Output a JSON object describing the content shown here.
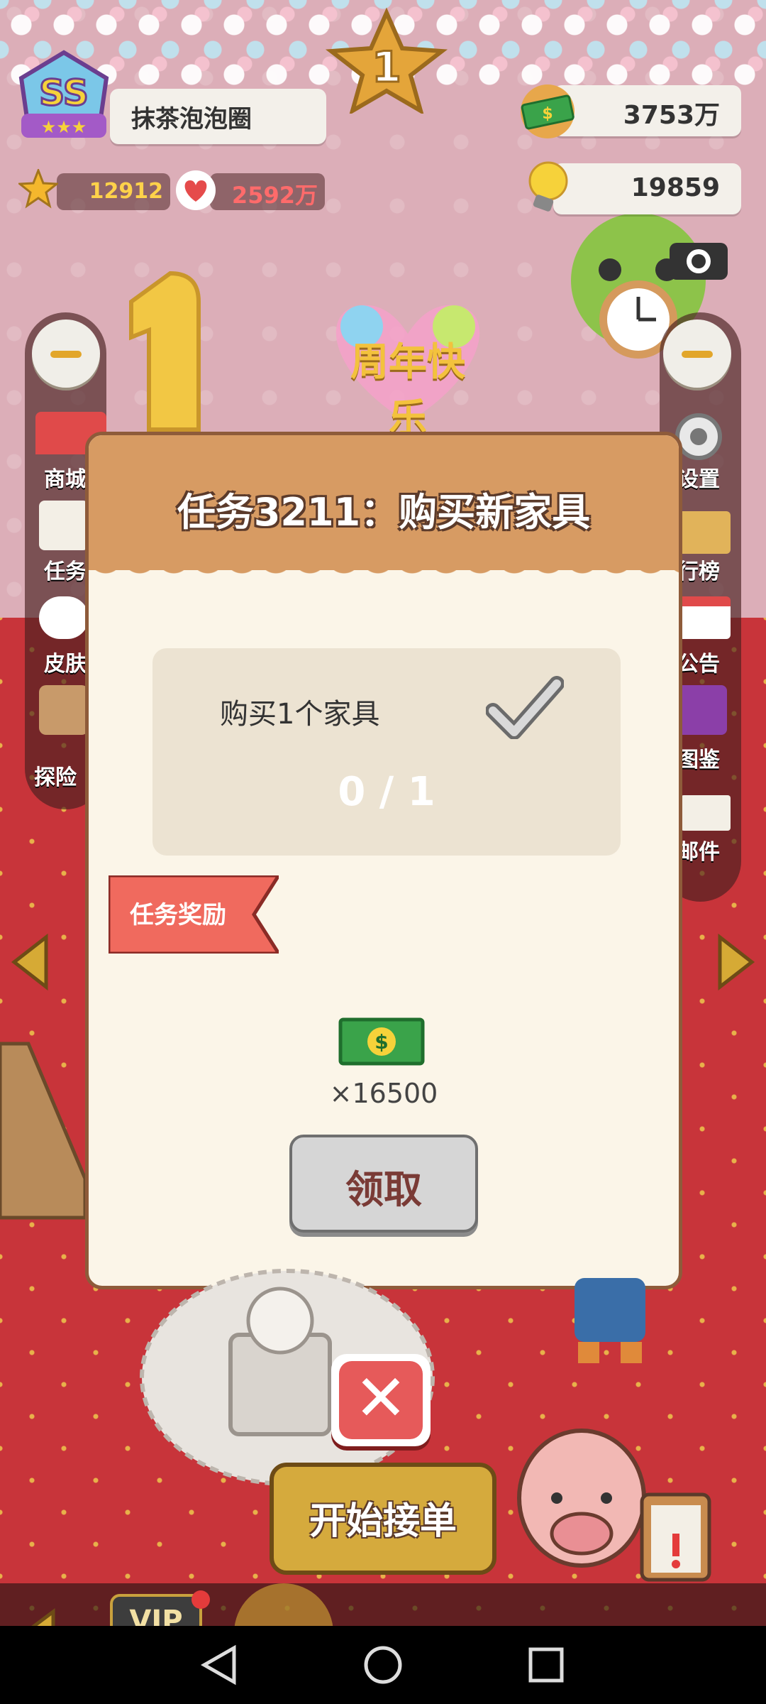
{
  "player": {
    "rank": "SS",
    "name": "抹茶泡泡圈",
    "stars": "12912",
    "likes": "2592万"
  },
  "currency": {
    "money": "3753万",
    "ideas": "19859"
  },
  "left_menu": [
    {
      "label": "商城"
    },
    {
      "label": "任务"
    },
    {
      "label": "皮肤"
    },
    {
      "label": "探险"
    }
  ],
  "right_menu": [
    {
      "label": "设置"
    },
    {
      "label": "行榜"
    },
    {
      "label": "公告"
    },
    {
      "label": "图鉴"
    },
    {
      "label": "邮件"
    }
  ],
  "banner": {
    "anniversary": "周年快乐",
    "number": "1"
  },
  "modal": {
    "title": "任务3211：购买新家具",
    "task_desc": "购买1个家具",
    "progress": "0 / 1",
    "reward_label": "任务奖励",
    "reward_amount": "×16500",
    "claim_label": "领取"
  },
  "bottom": {
    "start_label": "开始接单",
    "vip_label": "VIP"
  },
  "colors": {
    "accent_gold": "#d5aa3d",
    "close_red": "#e65a5a",
    "modal_header": "#d79b63"
  }
}
